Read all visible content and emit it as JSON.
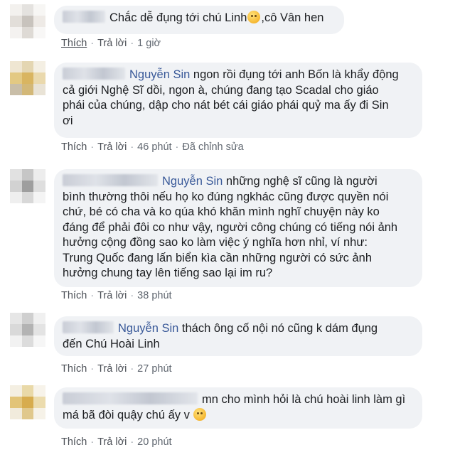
{
  "actions": {
    "like": "Thích",
    "reply": "Trả lời",
    "edited": "Đã chỉnh sửa"
  },
  "comments": [
    {
      "name": "",
      "lines": [
        "Chắc dễ đụng tới chú Linh",
        ",cô Vân hen"
      ],
      "emoji": "thinking-face",
      "time": "1 giờ"
    },
    {
      "name": "Nguyễn Sin",
      "lines": [
        "ngon rồi đụng tới anh Bốn là khẩy động",
        "cả giới Nghệ Sĩ dồi, ngon à, chúng đang tạo Scadal cho giáo",
        "phái của chúng, dập cho nát bét cái giáo phái quỷ ma ấy đi Sin",
        "ơi"
      ],
      "time": "46 phút"
    },
    {
      "name": "Nguyễn Sin",
      "lines": [
        "những nghệ sĩ cũng là người",
        "bình thường thôi nếu họ ko đúng ngkhác cũng được quyền nói",
        "chứ, bé có cha và ko qúa khó khăn mình nghĩ chuyện này ko",
        "đáng để phải đôi co như vậy, người công chúng có tiếng nói ảnh",
        "hưởng cộng đồng sao ko làm việc ý nghĩa hơn nhỉ, ví như:",
        "Trung Quốc đang lấn biển kìa cần những người có sức ảnh",
        "hưởng chung tay lên tiếng sao lại im ru?"
      ],
      "time": "38 phút"
    },
    {
      "name": "Nguyễn Sin",
      "lines": [
        "thách ông cố nội nó cũng k dám đụng",
        "đến Chú Hoài Linh"
      ],
      "time": "27 phút"
    },
    {
      "name": "",
      "lines": [
        "mn cho mình hỏi là chú hoài linh làm gì",
        "má bã đòi quậy chú ấy v"
      ],
      "emoji": "worried-face",
      "time": "20 phút"
    }
  ]
}
